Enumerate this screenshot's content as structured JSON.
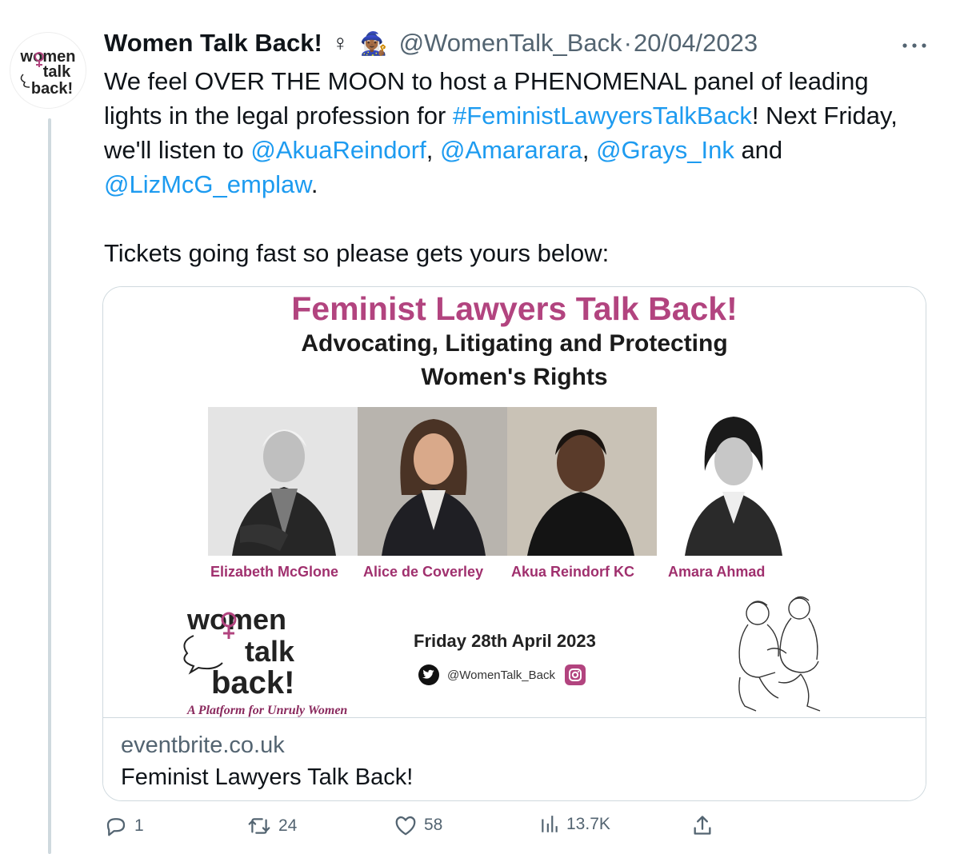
{
  "tweet": {
    "display_name": "Women Talk Back!",
    "badge_symbol": "♀",
    "badge_emoji": "🧙🏾‍♀️",
    "handle": "@WomenTalk_Back",
    "separator": "·",
    "date": "20/04/2023",
    "text": {
      "l1": "We feel OVER THE MOON to host a PHENOMENAL panel of leading lights in the legal profession for ",
      "hashtag": "#FeministLawyersTalkBack",
      "l2": "! Next Friday, we'll listen to ",
      "m1": "@AkuaReindorf",
      "c1": ", ",
      "m2": "@Amararara",
      "c2": ", ",
      "m3": "@Grays_Ink",
      "and": " and ",
      "m4": "@LizMcG_emplaw",
      "end": ".",
      "p2": "Tickets going fast so please gets yours below:"
    }
  },
  "avatar_logo": {
    "line1": "women",
    "line2": "talk",
    "line3": "back!"
  },
  "poster": {
    "title": "Feminist Lawyers Talk Back!",
    "subtitle_1": "Advocating, Litigating and Protecting",
    "subtitle_2": "Women's Rights",
    "speakers": [
      "Elizabeth McGlone",
      "Alice de Coverley",
      "Akua Reindorf KC",
      "Amara Ahmad"
    ],
    "logo_line1": "women",
    "logo_line2": "talk",
    "logo_line3": "back!",
    "logo_tagline": "A Platform for Unruly Women",
    "event_date": "Friday 28th April 2023",
    "social_handle": "@WomenTalk_Back"
  },
  "card": {
    "domain": "eventbrite.co.uk",
    "title": "Feminist Lawyers Talk Back!"
  },
  "actions": {
    "replies": "1",
    "retweets": "24",
    "likes": "58",
    "views": "13.7K"
  },
  "colors": {
    "link": "#1d9bf0",
    "muted": "#536471",
    "poster_pink": "#b2447f",
    "text": "#0f1419"
  },
  "icons": [
    "more-icon",
    "reply-icon",
    "retweet-icon",
    "like-icon",
    "views-icon",
    "share-icon",
    "twitter-bird-icon",
    "instagram-icon"
  ]
}
